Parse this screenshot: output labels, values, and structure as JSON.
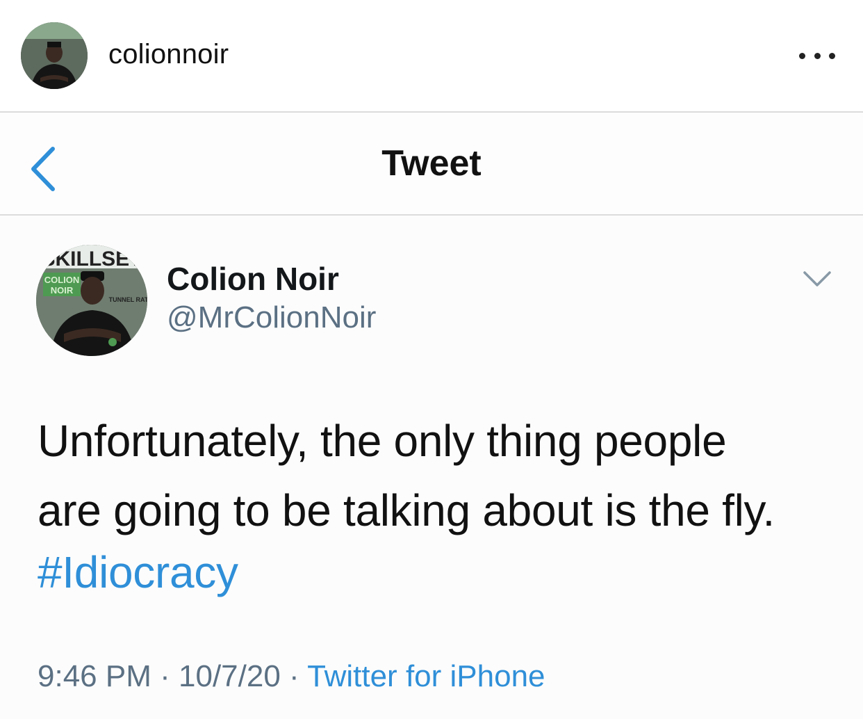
{
  "instagram": {
    "username": "colionnoir"
  },
  "twitter": {
    "nav_title": "Tweet",
    "display_name": "Colion Noir",
    "handle": "@MrColionNoir",
    "tweet_line1": "Unfortunately, the only thing people",
    "tweet_line2": "are going to be talking about is the fly.",
    "hashtag": "#Idiocracy",
    "time": "9:46 PM",
    "date": "10/7/20",
    "separator": "·",
    "source": "Twitter for iPhone"
  },
  "avatar_cover": {
    "masthead": "SKILLSET",
    "name_line1": "COLION",
    "name_line2": "NOIR",
    "headline": "TUNNEL RATS"
  },
  "icons": [
    "more-dots-icon",
    "back-chevron-icon",
    "caret-down-icon"
  ],
  "colors": {
    "link_blue": "#2f8fd8",
    "secondary_gray": "#5b7083",
    "divider": "#dcdcdc"
  }
}
